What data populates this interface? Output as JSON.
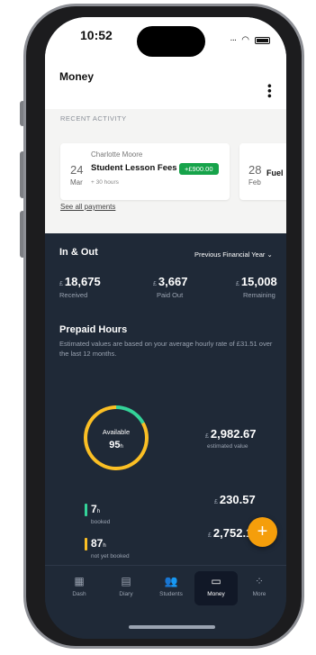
{
  "status": {
    "time": "10:52"
  },
  "header": {
    "title": "Money"
  },
  "recent": {
    "label": "RECENT ACTIVITY",
    "cards": [
      {
        "day": "24",
        "month": "Mar",
        "who": "Charlotte Moore",
        "what": "Student Lesson Fees",
        "duration": "+ 30 hours",
        "amount": "+£900.00"
      },
      {
        "day": "28",
        "month": "Feb",
        "what": "Fuel"
      }
    ],
    "see_all": "See all payments"
  },
  "in_out": {
    "title": "In & Out",
    "period": "Previous Financial Year",
    "currency": "£",
    "received": {
      "value": "18,675",
      "label": "Received"
    },
    "paid_out": {
      "value": "3,667",
      "label": "Paid Out"
    },
    "remaining": {
      "value": "15,008",
      "label": "Remaining"
    }
  },
  "prepaid": {
    "title": "Prepaid Hours",
    "description": "Estimated values are based on your average hourly rate of £31.51 over the last 12 months.",
    "available_label": "Available",
    "available_hours": "95",
    "hours_unit": "h",
    "estimated_value": "2,982.67",
    "estimated_label": "estimated value",
    "booked_hours": "7",
    "booked_label": "booked",
    "booked_value": "230.57",
    "not_booked_hours": "87",
    "not_booked_label": "not yet booked",
    "not_booked_value": "2,752.10"
  },
  "colors": {
    "accent": "#f59e0b",
    "green": "#16a34a",
    "ring_green": "#34d399",
    "ring_yellow": "#fbbf24",
    "dark_bg": "#1f2937"
  },
  "tabs": [
    {
      "label": "Dash",
      "icon": "grid-icon"
    },
    {
      "label": "Diary",
      "icon": "calendar-icon"
    },
    {
      "label": "Students",
      "icon": "people-icon"
    },
    {
      "label": "Money",
      "icon": "wallet-icon",
      "active": true
    },
    {
      "label": "More",
      "icon": "more-icon"
    }
  ]
}
